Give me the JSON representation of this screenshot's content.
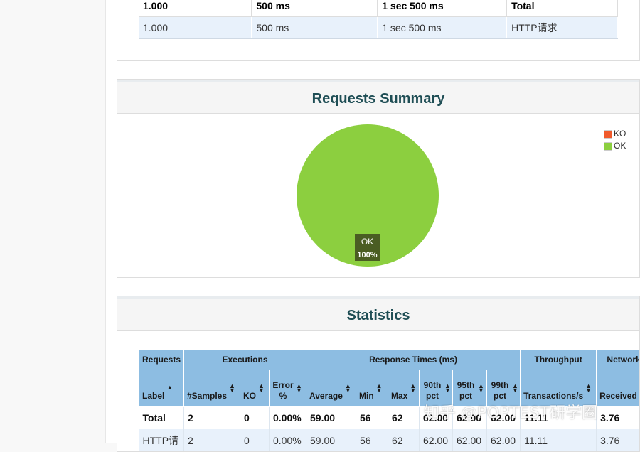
{
  "apdex": {
    "header": [
      "1.000",
      "500 ms",
      "1 sec 500 ms",
      "Total"
    ],
    "row": [
      "1.000",
      "500 ms",
      "1 sec 500 ms",
      "HTTP请求"
    ]
  },
  "summary": {
    "title": "Requests Summary",
    "legend": [
      {
        "label": "KO",
        "color": "#f05a2c"
      },
      {
        "label": "OK",
        "color": "#8ccf3f"
      }
    ],
    "pie_label_name": "OK",
    "pie_label_pct": "100%"
  },
  "chart_data": {
    "type": "pie",
    "title": "Requests Summary",
    "categories": [
      "KO",
      "OK"
    ],
    "values": [
      0,
      100
    ],
    "colors": [
      "#f05a2c",
      "#8ccf3f"
    ],
    "legend": "top-right"
  },
  "statistics": {
    "title": "Statistics",
    "groups": [
      "Requests",
      "Executions",
      "Response Times (ms)",
      "Throughput",
      "Network"
    ],
    "columns": [
      "Label",
      "#Samples",
      "KO",
      "Error %",
      "Average",
      "Min",
      "Max",
      "90th pct",
      "95th pct",
      "99th pct",
      "Transactions/s",
      "Received"
    ],
    "total": [
      "Total",
      "2",
      "0",
      "0.00%",
      "59.00",
      "56",
      "62",
      "62.00",
      "62.00",
      "62.00",
      "11.11",
      "3.76"
    ],
    "row": [
      "HTTP请",
      "2",
      "0",
      "0.00%",
      "59.00",
      "56",
      "62",
      "62.00",
      "62.00",
      "62.00",
      "11.11",
      "3.76"
    ]
  },
  "watermark": "知乎 @POPTEST研学圈"
}
